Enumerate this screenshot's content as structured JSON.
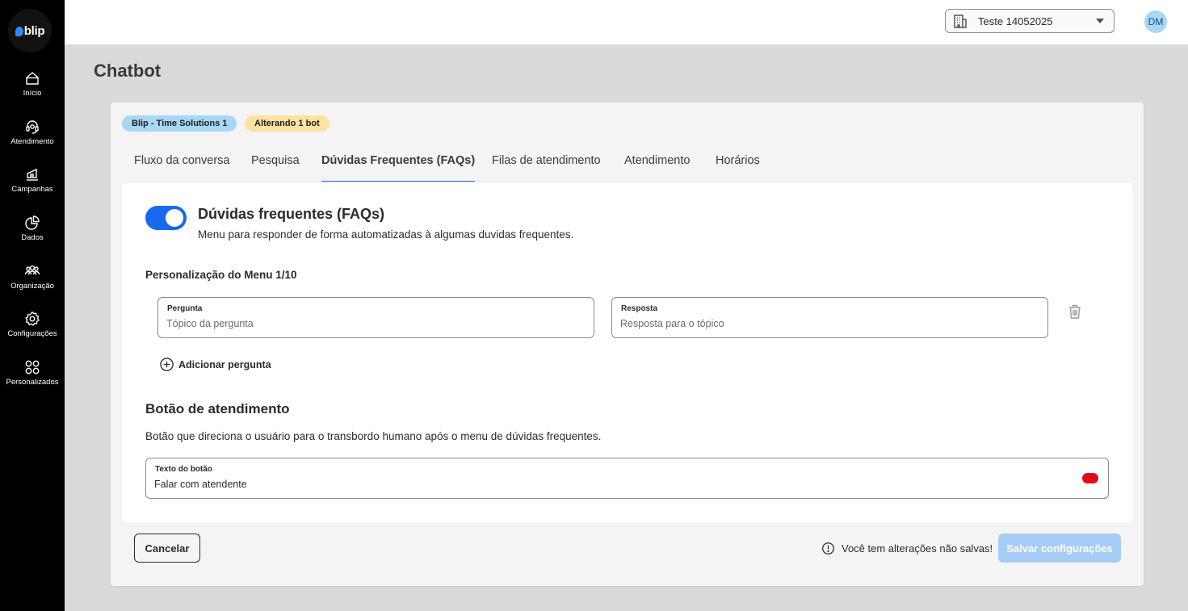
{
  "brand": {
    "logo_text": "blip",
    "logo_color": "#2d8cff"
  },
  "sidebar": {
    "items": [
      {
        "label": "Início",
        "icon": "home-icon"
      },
      {
        "label": "Atendimento",
        "icon": "headset-icon"
      },
      {
        "label": "Campanhas",
        "icon": "megaphone-icon"
      },
      {
        "label": "Dados",
        "icon": "pie-chart-icon"
      },
      {
        "label": "Organização",
        "icon": "users-icon"
      },
      {
        "label": "Configurações",
        "icon": "gear-icon"
      },
      {
        "label": "Personalizados",
        "icon": "grid-icon"
      }
    ]
  },
  "topbar": {
    "contract": "Teste 14052025",
    "avatar_initials": "DM"
  },
  "page": {
    "title": "Chatbot"
  },
  "chips": {
    "bot_name": "Blip - Time Solutions 1",
    "status": "Alterando 1 bot"
  },
  "tabs": [
    {
      "label": "Fluxo da conversa"
    },
    {
      "label": "Pesquisa"
    },
    {
      "label": "Dúvidas Frequentes (FAQs)"
    },
    {
      "label": "Filas de atendimento"
    },
    {
      "label": "Atendimento"
    },
    {
      "label": "Horários"
    }
  ],
  "faq": {
    "enabled": true,
    "title": "Dúvidas frequentes (FAQs)",
    "description": "Menu para responder de forma automatizadas à algumas duvidas frequentes.",
    "menu_label": "Personalização do Menu 1/10",
    "question_label": "Pergunta",
    "question_placeholder": "Tópico da pergunta",
    "answer_label": "Resposta",
    "answer_placeholder": "Resposta para o tópico",
    "add_question": "Adicionar pergunta"
  },
  "service_button": {
    "title": "Botão de atendimento",
    "description": "Botão que direciona o usuário para o transbordo humano após o menu de dúvidas frequentes.",
    "field_label": "Texto do botão",
    "field_value": "Falar com atendente"
  },
  "footer": {
    "cancel": "Cancelar",
    "unsaved_msg": "Você tem alterações não salvas!",
    "save": "Salvar configurações"
  },
  "colors": {
    "primary": "#1968f0",
    "save_disabled": "#a6cdf5",
    "chip_blue": "#a6d8f5",
    "chip_yellow": "#fde2a0"
  }
}
